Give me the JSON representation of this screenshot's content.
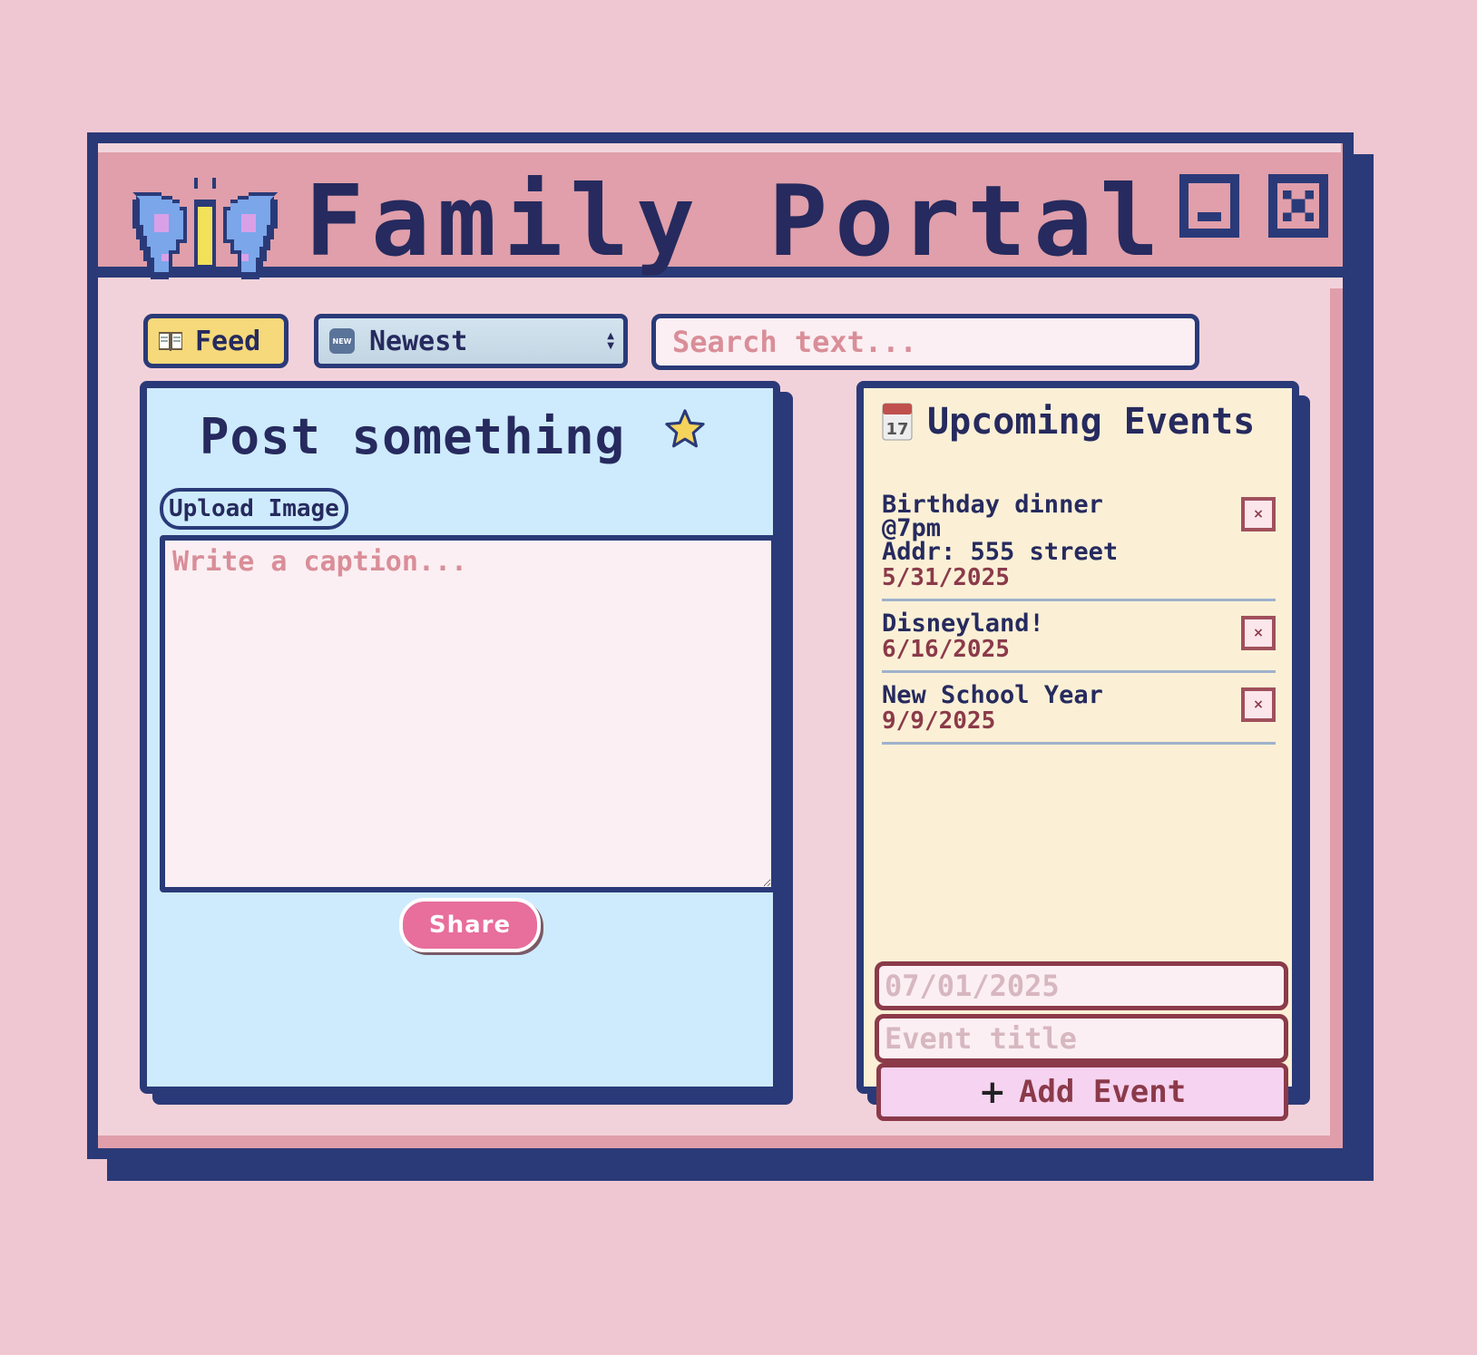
{
  "app": {
    "title": "Family Portal",
    "colors": {
      "page_bg": "#eec7d2",
      "frame": "#2a3a78",
      "titlebar": "#e09faa",
      "post_panel": "#ceebfd",
      "events_panel": "#fbf0d6",
      "accent_pink": "#e86e9c",
      "date_text": "#8b3a4a"
    }
  },
  "toolbar": {
    "feed_label": "Feed",
    "feed_icon": "open-book-icon",
    "sort_label": "Newest",
    "sort_icon": "new-badge-icon",
    "search_placeholder": "Search text..."
  },
  "post": {
    "title": "Post something",
    "title_icon": "star-icon",
    "upload_label": "Upload Image",
    "caption_placeholder": "Write a caption...",
    "share_label": "Share"
  },
  "events": {
    "title": "Upcoming Events",
    "title_icon": "calendar-icon",
    "calendar_icon_day": "17",
    "items": [
      {
        "title": "Birthday dinner\n@7pm\nAddr: 555 street",
        "date": "5/31/2025"
      },
      {
        "title": "Disneyland!",
        "date": "6/16/2025"
      },
      {
        "title": "New School Year",
        "date": "9/9/2025"
      }
    ],
    "delete_glyph": "×",
    "date_placeholder": "07/01/2025",
    "title_placeholder": "Event title",
    "add_label": "Add Event",
    "add_glyph": "+"
  }
}
